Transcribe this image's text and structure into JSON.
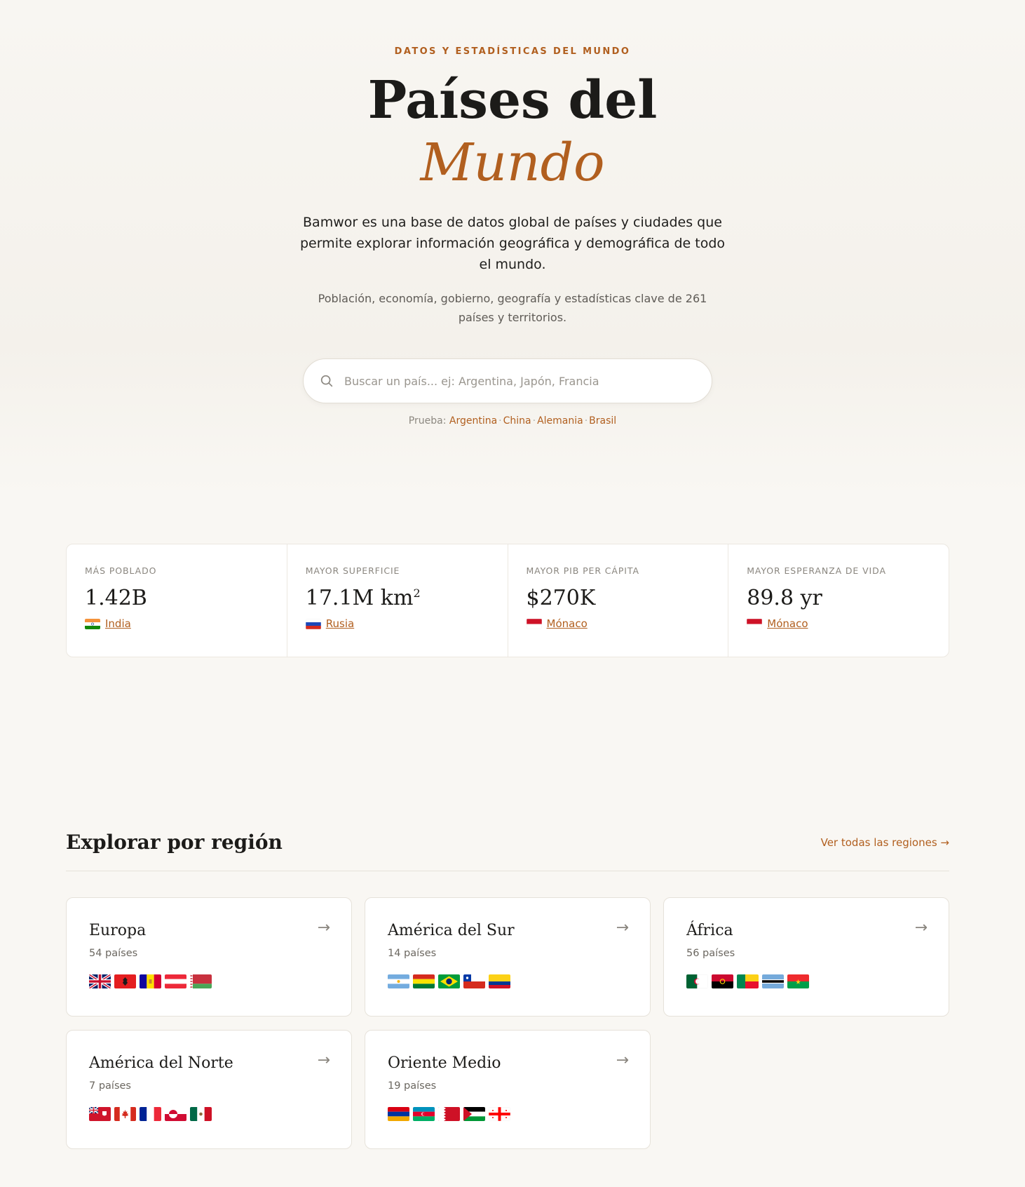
{
  "hero": {
    "eyebrow": "DATOS Y ESTADÍSTICAS DEL MUNDO",
    "title_line1": "Países del",
    "title_line2": "Mundo",
    "lead": "Bamwor es una base de datos global de países y ciudades que permite explorar información geográfica y demográfica de todo el mundo.",
    "sub": "Población, economía, gobierno, geografía y estadísticas clave de 261 países y territorios."
  },
  "search": {
    "placeholder": "Buscar un país... ej: Argentina, Japón, Francia",
    "icon": "search-icon"
  },
  "try": {
    "label": "Prueba:",
    "links": [
      "Argentina",
      "China",
      "Alemania",
      "Brasil"
    ],
    "separator": "·"
  },
  "stats": [
    {
      "label": "MÁS POBLADO",
      "value": "1.42B",
      "country": "India",
      "flag": "in"
    },
    {
      "label": "MAYOR SUPERFICIE",
      "value": "17.1M km",
      "superscript": "2",
      "country": "Rusia",
      "flag": "ru"
    },
    {
      "label": "MAYOR PIB PER CÁPITA",
      "value": "$270K",
      "country": "Mónaco",
      "flag": "mc"
    },
    {
      "label": "MAYOR ESPERANZA DE VIDA",
      "value": "89.8 yr",
      "country": "Mónaco",
      "flag": "mc"
    }
  ],
  "regions": {
    "title": "Explorar por región",
    "link": "Ver todas las regiones →",
    "arrow": "→",
    "items": [
      {
        "name": "Europa",
        "count": "54 países",
        "flags": [
          "gb",
          "al",
          "ad",
          "at",
          "by"
        ]
      },
      {
        "name": "América del Sur",
        "count": "14 países",
        "flags": [
          "ar",
          "bo",
          "br",
          "cl",
          "co"
        ]
      },
      {
        "name": "África",
        "count": "56 países",
        "flags": [
          "dz",
          "ao",
          "bj",
          "bw",
          "bf"
        ]
      },
      {
        "name": "América del Norte",
        "count": "7 países",
        "flags": [
          "bm",
          "ca",
          "fr",
          "gl",
          "mx"
        ]
      },
      {
        "name": "Oriente Medio",
        "count": "19 países",
        "flags": [
          "am",
          "az",
          "bh",
          "ps",
          "ge"
        ]
      }
    ]
  },
  "colors": {
    "accent": "#b15f1f",
    "background": "#f9f7f3",
    "text": "#1c1b19"
  }
}
